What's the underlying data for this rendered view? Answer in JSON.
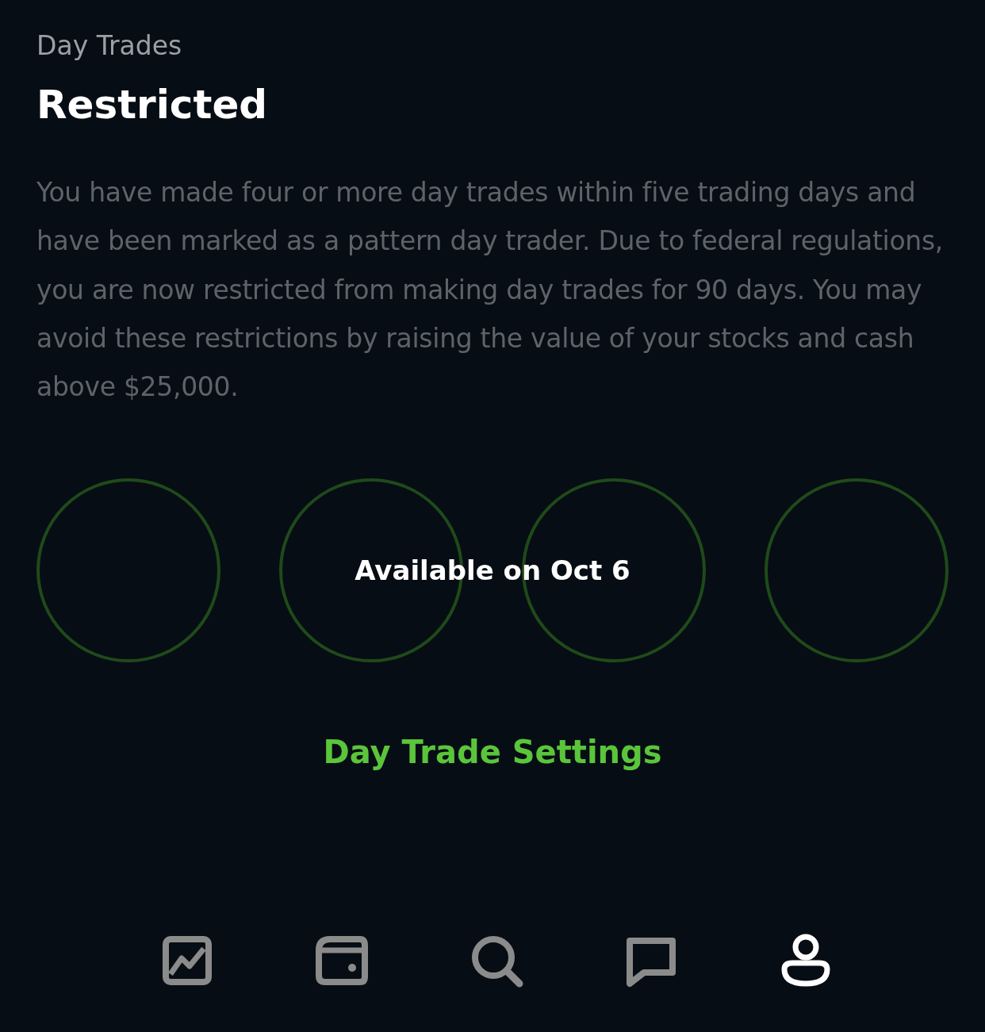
{
  "header": {
    "label": "Day Trades",
    "title": "Restricted",
    "description": "You have made four or more day trades within five trading days and have been marked as a pattern day trader. Due to federal regulations, you are now restricted from making day trades for 90 days. You may avoid these restrictions by raising the value of your stocks and cash above $25,000."
  },
  "slots": [
    {
      "used": false
    },
    {
      "used": false
    },
    {
      "used": false
    },
    {
      "used": false
    }
  ],
  "availability": "Available on Oct 6",
  "settings_link": "Day Trade Settings",
  "nav": [
    {
      "kind": "chart",
      "selected": false
    },
    {
      "kind": "wallet",
      "selected": false
    },
    {
      "kind": "search",
      "selected": false
    },
    {
      "kind": "messages",
      "selected": false
    },
    {
      "kind": "profile",
      "selected": true
    }
  ]
}
